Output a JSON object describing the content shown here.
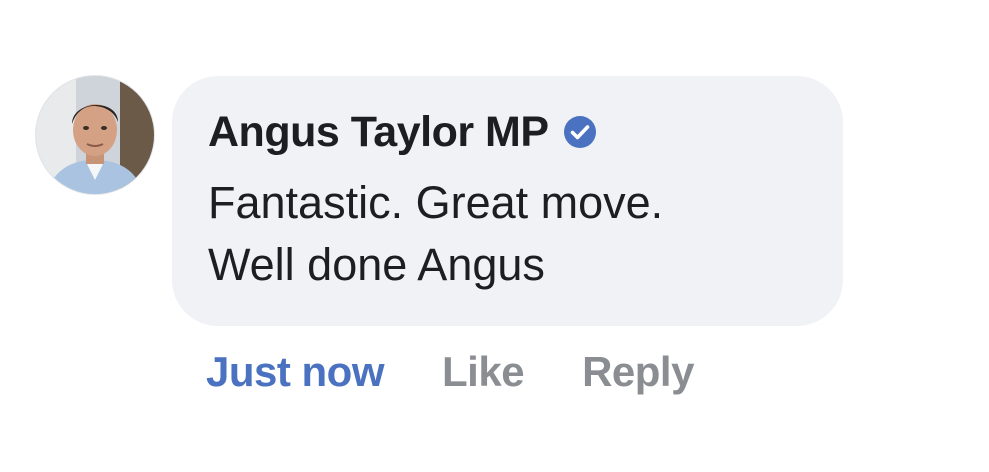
{
  "comment": {
    "author": "Angus Taylor MP",
    "verified": true,
    "text_lines": [
      "Fantastic. Great move.",
      "Well done Angus"
    ],
    "timestamp": "Just now",
    "actions": {
      "like": "Like",
      "reply": "Reply"
    }
  },
  "colors": {
    "bubble": "#f0f2f5",
    "text": "#1c1e21",
    "timestamp": "#4a72c0",
    "action": "#8a8d91",
    "verified_badge": "#4a72c0"
  },
  "icons": {
    "verified": "verified-check-icon"
  }
}
